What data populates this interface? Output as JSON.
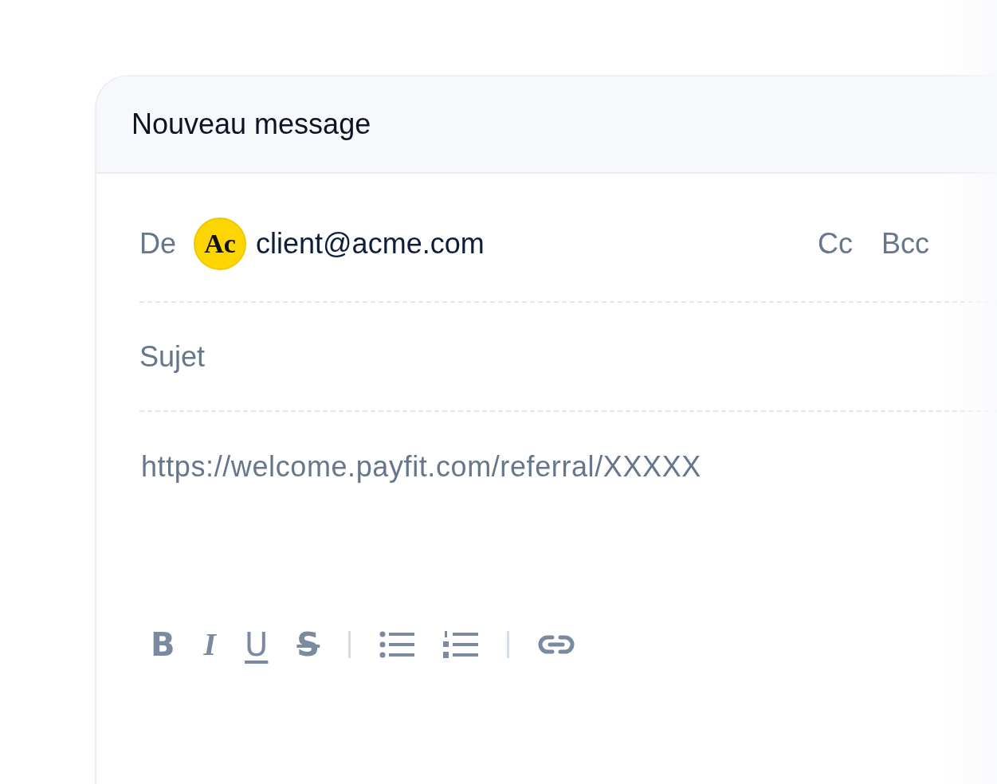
{
  "window": {
    "title": "Nouveau message"
  },
  "from": {
    "label": "De",
    "avatar": "Ac",
    "email": "client@acme.com"
  },
  "recipient_options": [
    "Cc",
    "Bcc"
  ],
  "subject": {
    "placeholder": "Sujet"
  },
  "body": {
    "text": "https://welcome.payfit.com/referral/XXXXX"
  },
  "toolbar": [
    {
      "kind": "bold",
      "label": "B"
    },
    {
      "kind": "italic",
      "label": "I"
    },
    {
      "kind": "underline",
      "label": "U"
    },
    {
      "kind": "strikethrough",
      "label": "S"
    },
    {
      "kind": "separator"
    },
    {
      "kind": "bullet_list"
    },
    {
      "kind": "numbered_list"
    },
    {
      "kind": "separator"
    },
    {
      "kind": "link"
    }
  ]
}
